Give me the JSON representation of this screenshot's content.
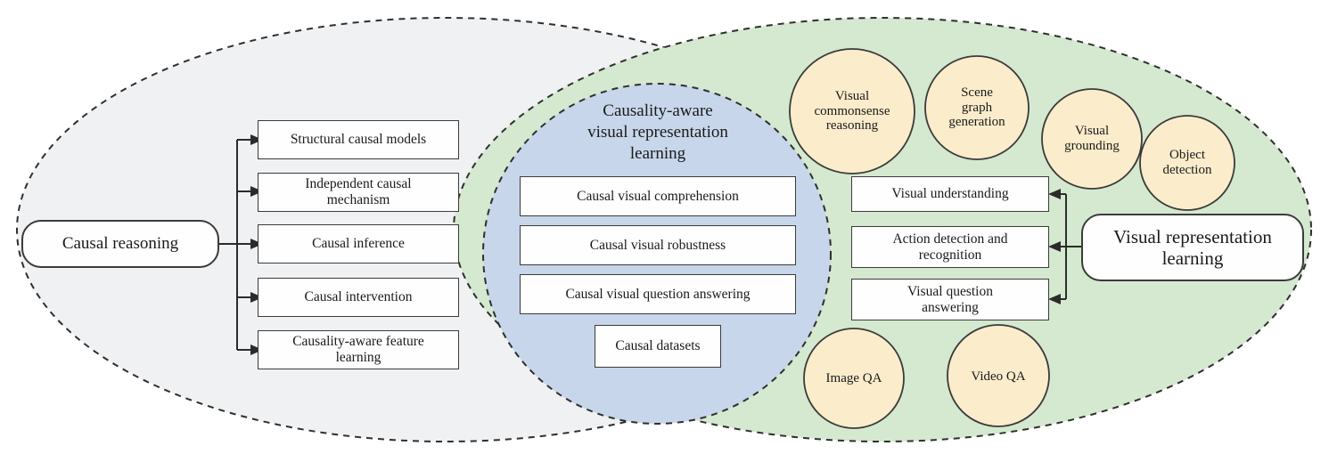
{
  "figure": {
    "type": "venn-taxonomy-diagram",
    "colors": {
      "left_ellipse_fill": "#f0f1f3",
      "right_ellipse_fill": "#d4e9cf",
      "center_ellipse_fill": "#c7d6ea",
      "bubble_fill": "#fbeccb",
      "stroke": "#3b3b3b",
      "box_fill": "#fefefe"
    }
  },
  "left_group": {
    "root_label": "Causal reasoning",
    "items": [
      "Structural causal models",
      "Independent causal\nmechanism",
      "Causal inference",
      "Causal intervention",
      "Causality-aware feature\nlearning"
    ]
  },
  "center_group": {
    "title": "Causality-aware\nvisual representation\nlearning",
    "items": [
      "Causal visual comprehension",
      "Causal visual robustness",
      "Causal visual question answering",
      "Causal datasets"
    ]
  },
  "right_group": {
    "root_label": "Visual representation\nlearning",
    "tasks": [
      "Visual understanding",
      "Action detection and\nrecognition",
      "Visual question\nanswering"
    ],
    "bubbles": [
      "Visual\ncommonsense\nreasoning",
      "Scene\ngraph\ngeneration",
      "Visual\ngrounding",
      "Object\ndetection",
      "Image QA",
      "Video QA"
    ]
  }
}
